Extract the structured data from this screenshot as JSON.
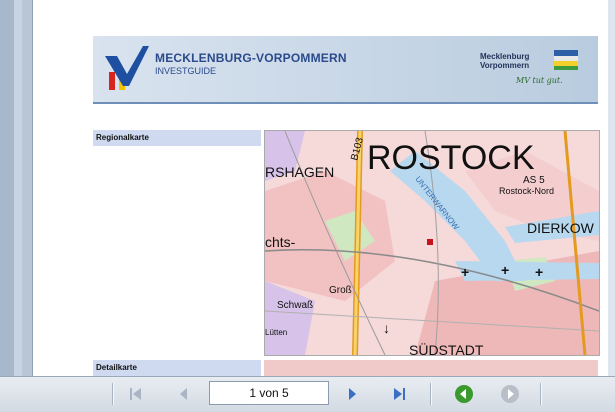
{
  "banner": {
    "title": "MECKLENBURG-VORPOMMERN",
    "subtitle": "INVESTGUIDE",
    "brand_line1": "Mecklenburg",
    "brand_line2": "Vorpommern",
    "brand_slogan": "MV tut gut."
  },
  "sections": {
    "regional_label": "Regionalkarte",
    "detail_label": "Detailkarte"
  },
  "map": {
    "labels": {
      "city": "ROSTOCK",
      "road": "B103",
      "hagen": "RSHAGEN",
      "exit": "AS 5",
      "exit_name": "Rostock-Nord",
      "dierkow": "DIERKOW",
      "river": "UNTERWARNOW",
      "chts": "chts-",
      "gross": "Groß",
      "schwass": "Schwaß",
      "suedstadt": "SÜDSTADT",
      "lutten": "Lütten"
    }
  },
  "toolbar": {
    "page_display": "1 von 5",
    "icons": {
      "first": "first-page-icon",
      "prev": "previous-page-icon",
      "next": "next-page-icon",
      "last": "last-page-icon",
      "back": "back-arrow-icon",
      "forward": "forward-arrow-icon"
    },
    "colors": {
      "nav_active": "#3a6fc4",
      "nav_disabled": "#a9b4c4",
      "back_green": "#3a9a2e"
    }
  }
}
